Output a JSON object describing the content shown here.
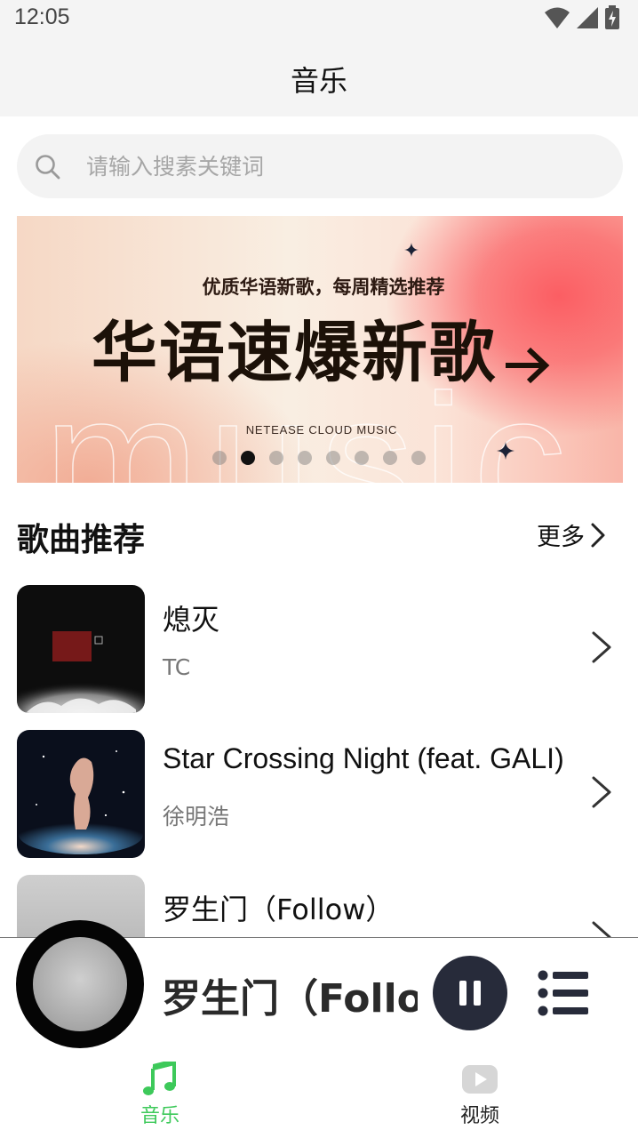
{
  "status_bar": {
    "time": "12:05"
  },
  "app_bar": {
    "title": "音乐"
  },
  "search": {
    "placeholder": "请输入搜素关键词"
  },
  "banner": {
    "subtitle": "优质华语新歌，每周精选推荐",
    "title": "华语速爆新歌",
    "brand": "NETEASE CLOUD MUSIC",
    "watermark": "music",
    "page_count": 8,
    "active_page": 2
  },
  "section": {
    "title": "歌曲推荐",
    "more_label": "更多"
  },
  "songs": [
    {
      "title": "熄灭",
      "artist": "TC"
    },
    {
      "title": "Star Crossing Night (feat. GALI)",
      "artist": "徐明浩"
    },
    {
      "title": "罗生门（Follow）",
      "artist": ""
    }
  ],
  "player": {
    "title": "罗生门（Follow）",
    "state": "playing"
  },
  "tabs": [
    {
      "label": "音乐",
      "icon": "music-note-icon",
      "active": true
    },
    {
      "label": "视频",
      "icon": "video-play-icon",
      "active": false
    }
  ],
  "colors": {
    "accent": "#3dc95a",
    "tab_inactive": "#222222",
    "player_button": "#272b3a",
    "banner_red": "#fb5e63"
  }
}
